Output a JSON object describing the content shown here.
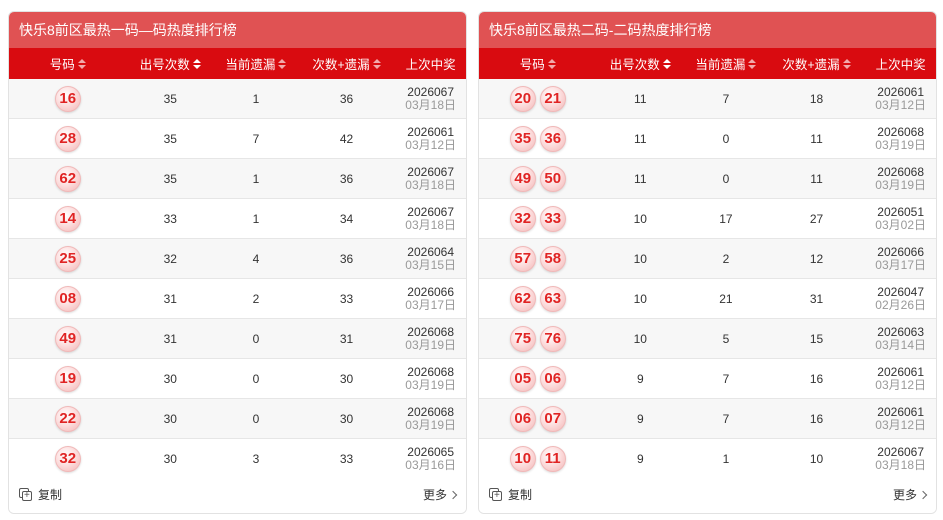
{
  "panels": [
    {
      "title": "快乐8前区最热一码—码热度排行榜",
      "headers": [
        "号码",
        "出号次数",
        "当前遗漏",
        "次数+遗漏",
        "上次中奖"
      ],
      "rows": [
        {
          "balls": [
            "16"
          ],
          "count": "35",
          "miss": "1",
          "sum": "36",
          "issue": "2026067",
          "date": "03月18日"
        },
        {
          "balls": [
            "28"
          ],
          "count": "35",
          "miss": "7",
          "sum": "42",
          "issue": "2026061",
          "date": "03月12日"
        },
        {
          "balls": [
            "62"
          ],
          "count": "35",
          "miss": "1",
          "sum": "36",
          "issue": "2026067",
          "date": "03月18日"
        },
        {
          "balls": [
            "14"
          ],
          "count": "33",
          "miss": "1",
          "sum": "34",
          "issue": "2026067",
          "date": "03月18日"
        },
        {
          "balls": [
            "25"
          ],
          "count": "32",
          "miss": "4",
          "sum": "36",
          "issue": "2026064",
          "date": "03月15日"
        },
        {
          "balls": [
            "08"
          ],
          "count": "31",
          "miss": "2",
          "sum": "33",
          "issue": "2026066",
          "date": "03月17日"
        },
        {
          "balls": [
            "49"
          ],
          "count": "31",
          "miss": "0",
          "sum": "31",
          "issue": "2026068",
          "date": "03月19日"
        },
        {
          "balls": [
            "19"
          ],
          "count": "30",
          "miss": "0",
          "sum": "30",
          "issue": "2026068",
          "date": "03月19日"
        },
        {
          "balls": [
            "22"
          ],
          "count": "30",
          "miss": "0",
          "sum": "30",
          "issue": "2026068",
          "date": "03月19日"
        },
        {
          "balls": [
            "32"
          ],
          "count": "30",
          "miss": "3",
          "sum": "33",
          "issue": "2026065",
          "date": "03月16日"
        }
      ],
      "copy_label": "复制",
      "more_label": "更多"
    },
    {
      "title": "快乐8前区最热二码-二码热度排行榜",
      "headers": [
        "号码",
        "出号次数",
        "当前遗漏",
        "次数+遗漏",
        "上次中奖"
      ],
      "rows": [
        {
          "balls": [
            "20",
            "21"
          ],
          "count": "11",
          "miss": "7",
          "sum": "18",
          "issue": "2026061",
          "date": "03月12日"
        },
        {
          "balls": [
            "35",
            "36"
          ],
          "count": "11",
          "miss": "0",
          "sum": "11",
          "issue": "2026068",
          "date": "03月19日"
        },
        {
          "balls": [
            "49",
            "50"
          ],
          "count": "11",
          "miss": "0",
          "sum": "11",
          "issue": "2026068",
          "date": "03月19日"
        },
        {
          "balls": [
            "32",
            "33"
          ],
          "count": "10",
          "miss": "17",
          "sum": "27",
          "issue": "2026051",
          "date": "03月02日"
        },
        {
          "balls": [
            "57",
            "58"
          ],
          "count": "10",
          "miss": "2",
          "sum": "12",
          "issue": "2026066",
          "date": "03月17日"
        },
        {
          "balls": [
            "62",
            "63"
          ],
          "count": "10",
          "miss": "21",
          "sum": "31",
          "issue": "2026047",
          "date": "02月26日"
        },
        {
          "balls": [
            "75",
            "76"
          ],
          "count": "10",
          "miss": "5",
          "sum": "15",
          "issue": "2026063",
          "date": "03月14日"
        },
        {
          "balls": [
            "05",
            "06"
          ],
          "count": "9",
          "miss": "7",
          "sum": "16",
          "issue": "2026061",
          "date": "03月12日"
        },
        {
          "balls": [
            "06",
            "07"
          ],
          "count": "9",
          "miss": "7",
          "sum": "16",
          "issue": "2026061",
          "date": "03月12日"
        },
        {
          "balls": [
            "10",
            "11"
          ],
          "count": "9",
          "miss": "1",
          "sum": "10",
          "issue": "2026067",
          "date": "03月18日"
        }
      ],
      "copy_label": "复制",
      "more_label": "更多"
    }
  ],
  "colors": {
    "title_bg": "#e05253",
    "header_bg": "#d90b10",
    "ball_text": "#e02424"
  },
  "icons": {
    "sort": "sort-icon",
    "copy": "copy-icon",
    "more": "chevron-right-icon"
  },
  "active_sort_column": 1
}
